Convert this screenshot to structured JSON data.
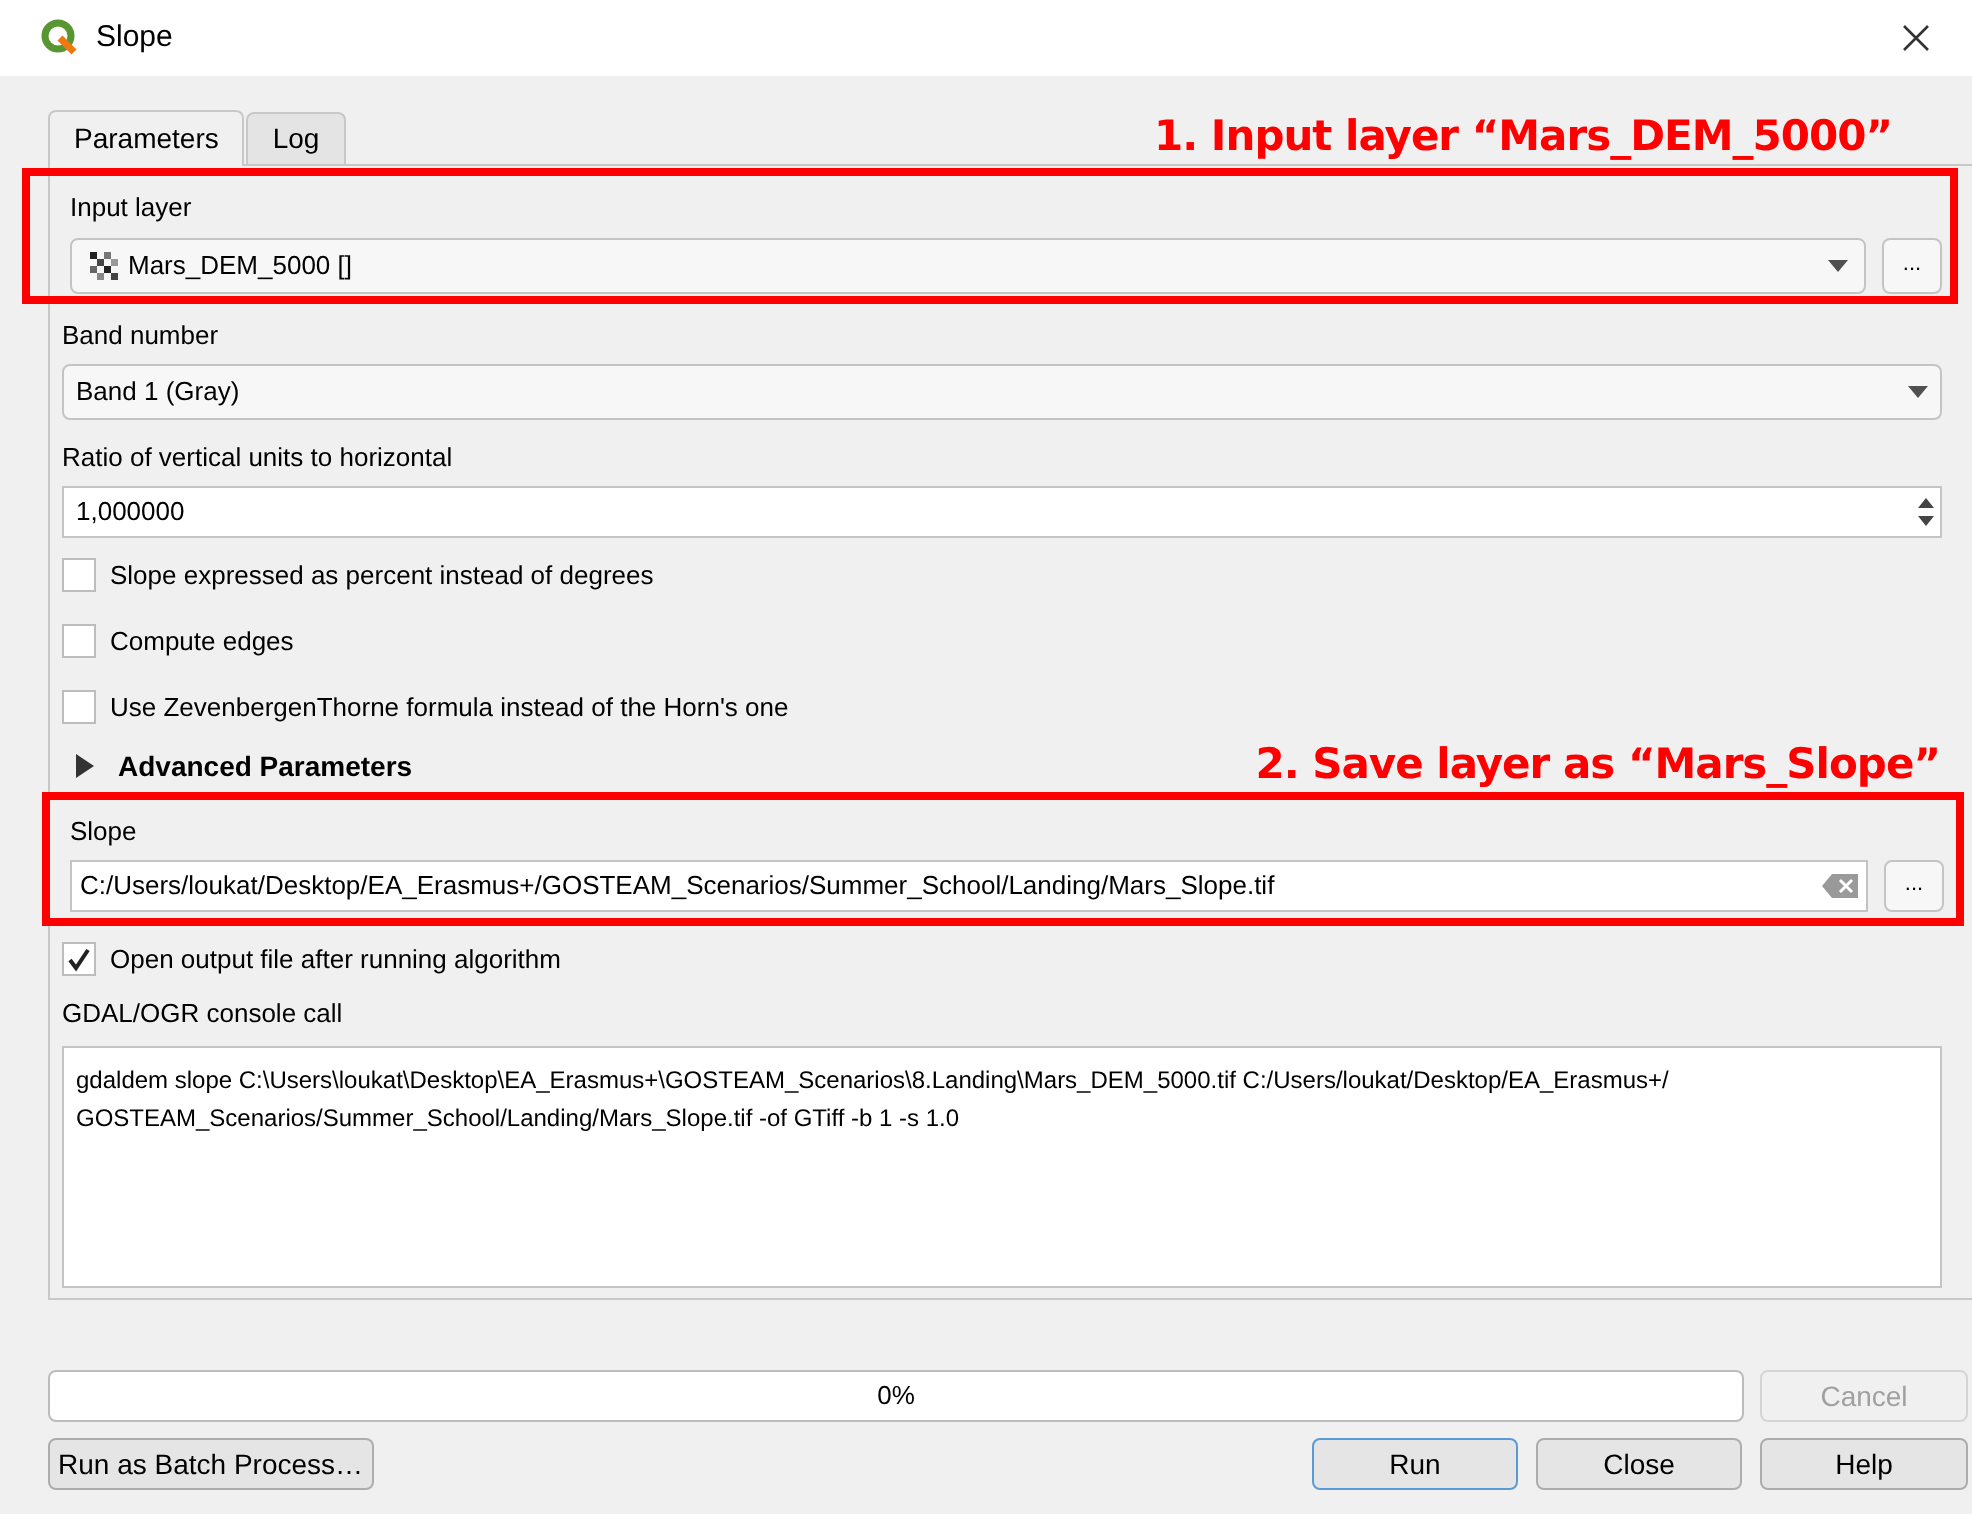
{
  "window": {
    "title": "Slope"
  },
  "tabs": [
    {
      "label": "Parameters",
      "selected": true
    },
    {
      "label": "Log",
      "selected": false
    }
  ],
  "annotations": [
    {
      "text": "1. Input layer “Mars_DEM_5000”"
    },
    {
      "text": "2. Save layer as “Mars_Slope”"
    }
  ],
  "input_layer": {
    "label": "Input layer",
    "value": "Mars_DEM_5000 []",
    "browse": "..."
  },
  "band_number": {
    "label": "Band number",
    "value": "Band 1 (Gray)"
  },
  "ratio": {
    "label": "Ratio of vertical units to horizontal",
    "value": "1,000000"
  },
  "options": [
    {
      "label": "Slope expressed as percent instead of degrees",
      "checked": false
    },
    {
      "label": "Compute edges",
      "checked": false
    },
    {
      "label": "Use ZevenbergenThorne formula instead of the Horn's one",
      "checked": false
    }
  ],
  "advanced": {
    "label": "Advanced Parameters",
    "expanded": false
  },
  "output": {
    "label": "Slope",
    "value": "C:/Users/loukat/Desktop/EA_Erasmus+/GOSTEAM_Scenarios/Summer_School/Landing/Mars_Slope.tif",
    "browse": "..."
  },
  "open_output": {
    "label": "Open output file after running algorithm",
    "checked": true
  },
  "console": {
    "label": "GDAL/OGR console call",
    "text": "gdaldem slope C:\\Users\\loukat\\Desktop\\EA_Erasmus+\\GOSTEAM_Scenarios\\8.Landing\\Mars_DEM_5000.tif C:/Users/loukat/Desktop/EA_Erasmus+/ GOSTEAM_Scenarios/Summer_School/Landing/Mars_Slope.tif -of GTiff -b 1 -s 1.0"
  },
  "progress": {
    "level": 0,
    "reading": "0%"
  },
  "buttons": [
    {
      "label": "Cancel",
      "disabled": true
    },
    {
      "label": "Run as Batch Process…",
      "disabled": false
    },
    {
      "label": "Run",
      "disabled": false
    },
    {
      "label": "Close",
      "disabled": false
    },
    {
      "label": "Help",
      "disabled": false
    }
  ]
}
